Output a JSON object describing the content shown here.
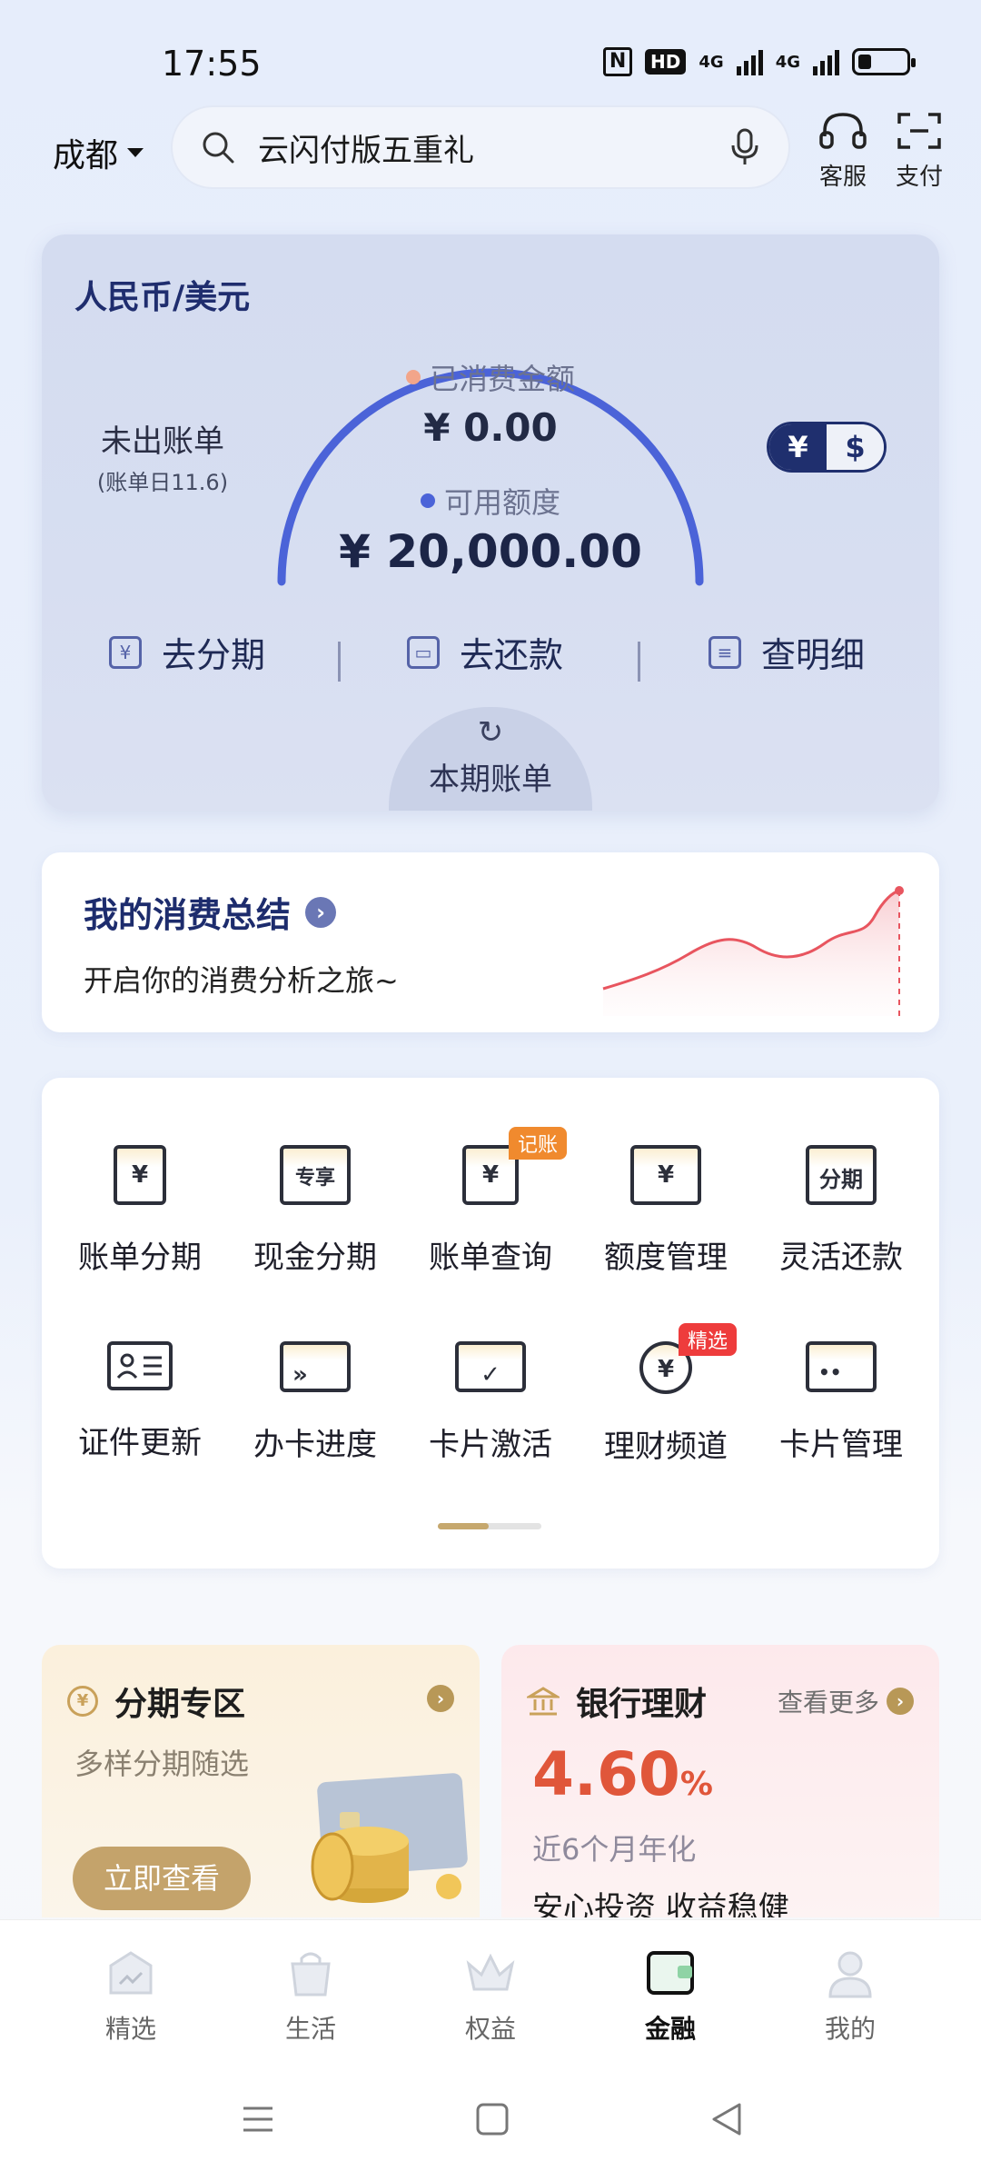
{
  "status_bar": {
    "time": "17:55",
    "icons": [
      "nfc-icon",
      "hd-icon",
      "4g-signal-icon",
      "4g-signal-icon",
      "battery-icon"
    ],
    "hd": "HD",
    "net1": "4G",
    "net2": "4G"
  },
  "header": {
    "city": "成都",
    "search_placeholder": "云闪付版五重礼",
    "service_label": "客服",
    "pay_label": "支付"
  },
  "credit": {
    "title": "人民币/美元",
    "unbilled": "未出账单",
    "bill_day": "(账单日11.6)",
    "spent_label": "已消费金额",
    "spent_value": "¥ 0.00",
    "available_label": "可用额度",
    "available_value": "¥ 20,000.00",
    "currency_cny": "¥",
    "currency_usd": "$",
    "actions": [
      "去分期",
      "去还款",
      "查明细"
    ],
    "bill_tab": "本期账单",
    "colors": {
      "spent_dot": "#f2a58a",
      "available_dot": "#4b63d8",
      "arc": "#4b63d8"
    }
  },
  "summary": {
    "title": "我的消费总结",
    "subtitle": "开启你的消费分析之旅~"
  },
  "menu": {
    "items": [
      {
        "label": "账单分期",
        "icon": "bill-installment-icon",
        "glyph": "¥"
      },
      {
        "label": "现金分期",
        "icon": "cash-installment-icon",
        "glyph": "专享"
      },
      {
        "label": "账单查询",
        "icon": "bill-query-icon",
        "glyph": "¥",
        "badge": "记账"
      },
      {
        "label": "额度管理",
        "icon": "limit-management-icon",
        "glyph": "¥"
      },
      {
        "label": "灵活还款",
        "icon": "flexible-repayment-icon",
        "glyph": "分期"
      },
      {
        "label": "证件更新",
        "icon": "id-update-icon",
        "glyph": ""
      },
      {
        "label": "办卡进度",
        "icon": "card-progress-icon",
        "glyph": "»"
      },
      {
        "label": "卡片激活",
        "icon": "card-activation-icon",
        "glyph": "✓"
      },
      {
        "label": "理财频道",
        "icon": "wealth-channel-icon",
        "glyph": "¥",
        "badge": "精选"
      },
      {
        "label": "卡片管理",
        "icon": "card-management-icon",
        "glyph": "••"
      }
    ],
    "badge_colors": {
      "记账": "#f08a2e",
      "精选": "#ee3c3c"
    }
  },
  "promo": {
    "installment_title": "分期专区",
    "installment_sub": "多样分期随选",
    "installment_button": "立即查看",
    "wealth_title": "银行理财",
    "wealth_more": "查看更多",
    "rate_value": "4.60",
    "rate_unit": "%",
    "rate_sub": "近6个月年化",
    "slogan": "安心投资 收益稳健"
  },
  "bottom_nav": {
    "items": [
      "精选",
      "生活",
      "权益",
      "金融",
      "我的"
    ],
    "active": "金融"
  }
}
